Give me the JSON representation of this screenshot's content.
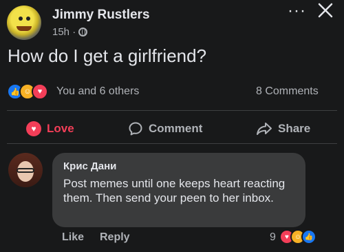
{
  "post": {
    "author": "Jimmy Rustlers",
    "time": "15h ·",
    "more_label": "···",
    "text": "How do I get a girlfriend?",
    "reactions": [
      "like-icon",
      "care-icon",
      "love-icon"
    ],
    "reaction_summary": "You and 6 others",
    "comments_count": "8 Comments"
  },
  "actions": {
    "love": "Love",
    "comment": "Comment",
    "share": "Share"
  },
  "comment": {
    "author": "Крис Дани",
    "text": "Post memes until one keeps heart reacting them. Then send your peen to her inbox.",
    "like": "Like",
    "reply": "Reply",
    "reaction_count": "9",
    "reactions": [
      "love-icon",
      "care-icon",
      "like-icon"
    ]
  },
  "colors": {
    "background": "#18191a",
    "love": "#f33e58",
    "like": "#1877f2",
    "care": "#f7b125",
    "bubble": "#3a3b3c"
  }
}
